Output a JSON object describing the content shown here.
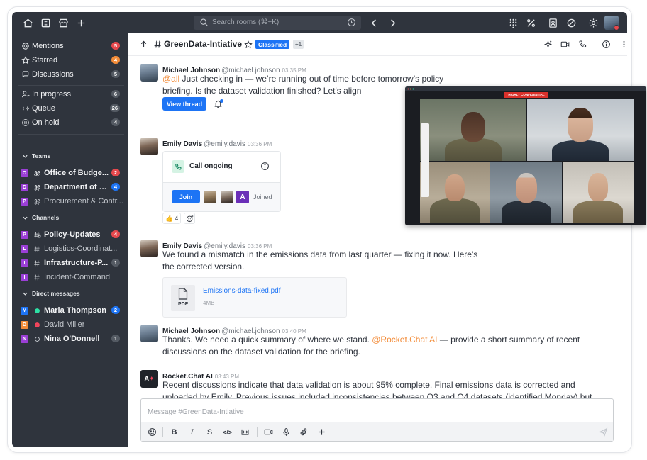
{
  "topbar": {
    "search_placeholder": "Search rooms (⌘+K)"
  },
  "sidebar": {
    "primary": [
      {
        "label": "Mentions",
        "badge": "5",
        "badge_color": "red"
      },
      {
        "label": "Starred",
        "badge": "4",
        "badge_color": "orange"
      },
      {
        "label": "Discussions",
        "badge": "5",
        "badge_color": "grey"
      }
    ],
    "queue": [
      {
        "label": "In progress",
        "badge": "6"
      },
      {
        "label": "Queue",
        "badge": "26"
      },
      {
        "label": "On hold",
        "badge": "4"
      }
    ],
    "teams_title": "Teams",
    "teams": [
      {
        "avatar": "O",
        "avatar_color": "#9b3fd6",
        "label": "Office of Budge...",
        "badge": "2",
        "badge_color": "red",
        "bold": true
      },
      {
        "avatar": "D",
        "avatar_color": "#9b3fd6",
        "label": "Department of E...",
        "badge": "4",
        "badge_color": "blue",
        "bold": true
      },
      {
        "avatar": "P",
        "avatar_color": "#9b3fd6",
        "label": "Procurement & Contr...",
        "badge": "",
        "bold": false
      }
    ],
    "channels_title": "Channels",
    "channels": [
      {
        "avatar": "P",
        "avatar_color": "#9b3fd6",
        "label": "Policy-Updates",
        "badge": "4",
        "badge_color": "red",
        "bold": true
      },
      {
        "avatar": "L",
        "avatar_color": "#9b3fd6",
        "label": "Logistics-Coordinat...",
        "badge": "",
        "bold": false
      },
      {
        "avatar": "I",
        "avatar_color": "#9b3fd6",
        "label": "Infrastructure-P...",
        "badge": "1",
        "badge_color": "grey",
        "bold": true
      },
      {
        "avatar": "I",
        "avatar_color": "#9b3fd6",
        "label": "Incident-Command",
        "badge": "",
        "bold": false
      }
    ],
    "dm_title": "Direct messages",
    "dms": [
      {
        "avatar": "M",
        "avatar_color": "#1d74f5",
        "status": "online",
        "label": "Maria Thompson",
        "badge": "2",
        "badge_color": "blue",
        "bold": true
      },
      {
        "avatar": "D",
        "avatar_color": "#f38c39",
        "status": "busy",
        "label": "David Miller",
        "badge": "",
        "bold": false
      },
      {
        "avatar": "N",
        "avatar_color": "#9b3fd6",
        "status": "offline",
        "label": "Nina O'Donnell",
        "badge": "1",
        "badge_color": "grey",
        "bold": true
      }
    ]
  },
  "room": {
    "name": "GreenData-Intiative",
    "tag": "Classified",
    "extra": "+1"
  },
  "messages": {
    "m1": {
      "name": "Michael Johnson",
      "user": "@michael.johnson",
      "time": "03:35 PM",
      "mention": "@all",
      "text": " Just checking in — we’re running out of time before tomorrow’s policy briefing. Is the dataset validation finished? Let's align",
      "button": "View thread"
    },
    "m2": {
      "name": "Emily Davis",
      "user": "@emily.davis",
      "time": "03:36 PM",
      "call_title": "Call ongoing",
      "join": "Join",
      "joined": "Joined",
      "participant_letter": "A",
      "reaction_emoji": "👍",
      "reaction_count": "4"
    },
    "m3": {
      "name": "Emily Davis",
      "user": "@emily.davis",
      "time": "03:36 PM",
      "text": "We found a mismatch in the emissions data from last quarter — fixing it now. Here's the corrected version.",
      "file_name": "Emissions-data-fixed.pdf",
      "file_type": "PDF",
      "file_size": "4MB"
    },
    "m4": {
      "name": "Michael Johnson",
      "user": "@michael.johnson",
      "time": "03:40 PM",
      "text_before": "Thanks. We need a quick summary of where we stand. ",
      "mention": "@Rocket.Chat AI",
      "text_after": " — provide a short summary of recent discussions on the dataset validation for the briefing."
    },
    "m5": {
      "name": "Rocket.Chat AI",
      "time": "03:43 PM",
      "text": "Recent discussions indicate that data validation is about 95% complete. Final emissions data is corrected and uploaded by Emily. Previous issues included inconsistencies between Q3 and Q4 datasets (identified Monday) but have been resolved on Tuesday. Integration test was verified by the analytics team yesterday; no further"
    }
  },
  "composer": {
    "placeholder": "Message #GreenData-Intiative"
  },
  "video_call": {
    "banner": "HIGHLY CONFIDENTIAL"
  }
}
